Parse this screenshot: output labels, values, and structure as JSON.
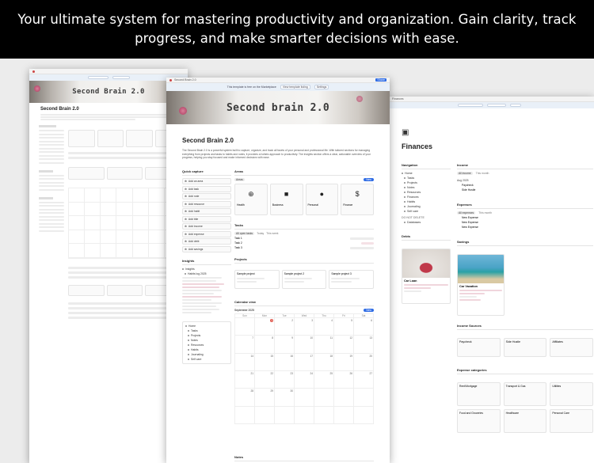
{
  "banner": {
    "line1": "Your ultimate system for mastering productivity and organization. Gain clarity, track",
    "line2": "progress, and make smarter decisions with ease."
  },
  "left_shot": {
    "cover_title": "Second Brain 2.0",
    "heading": "Second Brain 2.0"
  },
  "center_shot": {
    "tab_title": "Second Brain 2.0",
    "promo_text": "This template is free on the Marketplace",
    "promo_btn_1": "View template listing",
    "promo_btn_2": "Settings",
    "cover_title": "Second brain 2.0",
    "heading": "Second Brain 2.0",
    "description": "The Second Brain 2.0 is a powerful system built to capture, organize, and track all facets of your personal and professional life. With tailored sections for managing everything from projects and tasks to habits and notes, it provides a holistic approach to productivity. The Insights section offers a clear, actionable overview of your progress, helping you stay focused and make informed decisions with ease.",
    "quick_capture": {
      "label": "Quick capture",
      "items": [
        "Add an area",
        "Add task",
        "Add note",
        "Add resource",
        "Add habit",
        "Add bite",
        "Add income",
        "Add expense",
        "Add debt",
        "Add savings"
      ]
    },
    "insights": {
      "label": "Insights",
      "items": [
        "Insights",
        "Habits log 2025",
        "Habits",
        "Savings"
      ]
    },
    "home_nav": [
      "Home",
      "Tasks",
      "Projects",
      "Notes",
      "Resources",
      "Habits",
      "Journaling",
      "Self care"
    ],
    "areas": {
      "label": "Areas",
      "cards": [
        {
          "icon": "add-icon",
          "name": "Health"
        },
        {
          "icon": "briefcase-icon",
          "name": "Business"
        },
        {
          "icon": "person-icon",
          "name": "Personal"
        },
        {
          "icon": "dollar-icon",
          "name": "Finance"
        }
      ]
    },
    "tasks": {
      "label": "Tasks",
      "rows": [
        "Task 1",
        "Task 2",
        "Task 3"
      ],
      "new_button": "New"
    },
    "projects": {
      "label": "Projects",
      "cards": [
        "Sample project",
        "Sample project 2",
        "Sample project 3"
      ]
    },
    "calendar": {
      "label": "Calendar view",
      "month": "September 2025",
      "weekdays": [
        "Sun",
        "Mon",
        "Tue",
        "Wed",
        "Thu",
        "Fri",
        "Sat"
      ],
      "today": "1"
    },
    "notes_label": "Notes"
  },
  "right_shot": {
    "tab_title": "Finances",
    "heading": "Finances",
    "navigation": {
      "label": "Navigation",
      "items": [
        "Home",
        "Tasks",
        "Projects",
        "Notes",
        "Resources",
        "Finances",
        "Habits",
        "Journaling",
        "Self care"
      ],
      "do_not_delete": "Do not delete",
      "database_item": "Databases"
    },
    "income": {
      "label": "Income",
      "rows": [
        "Paycheck",
        "Side Hustle"
      ]
    },
    "expenses": {
      "label": "Expenses",
      "rows": [
        "New Expense",
        "New Expense",
        "New Expense"
      ]
    },
    "debts_label": "Debts",
    "car_loan": "Car Loan",
    "savings": {
      "label": "Savings",
      "card_title": "Car Vacation"
    },
    "income_sources": {
      "label": "Income Sources",
      "cards": [
        "Paycheck",
        "Side Hustle",
        "Affiliates"
      ]
    },
    "expense_categories": {
      "label": "Expense categories",
      "cards": [
        "Rent/Mortgage",
        "Transport & Gas",
        "Utilities",
        "Food and Groceries",
        "Healthcare",
        "Personal Care"
      ]
    }
  },
  "colors": {
    "accent_blue": "#2f6ce5",
    "accent_pink": "#c0446a",
    "banner_bg": "#000000"
  }
}
